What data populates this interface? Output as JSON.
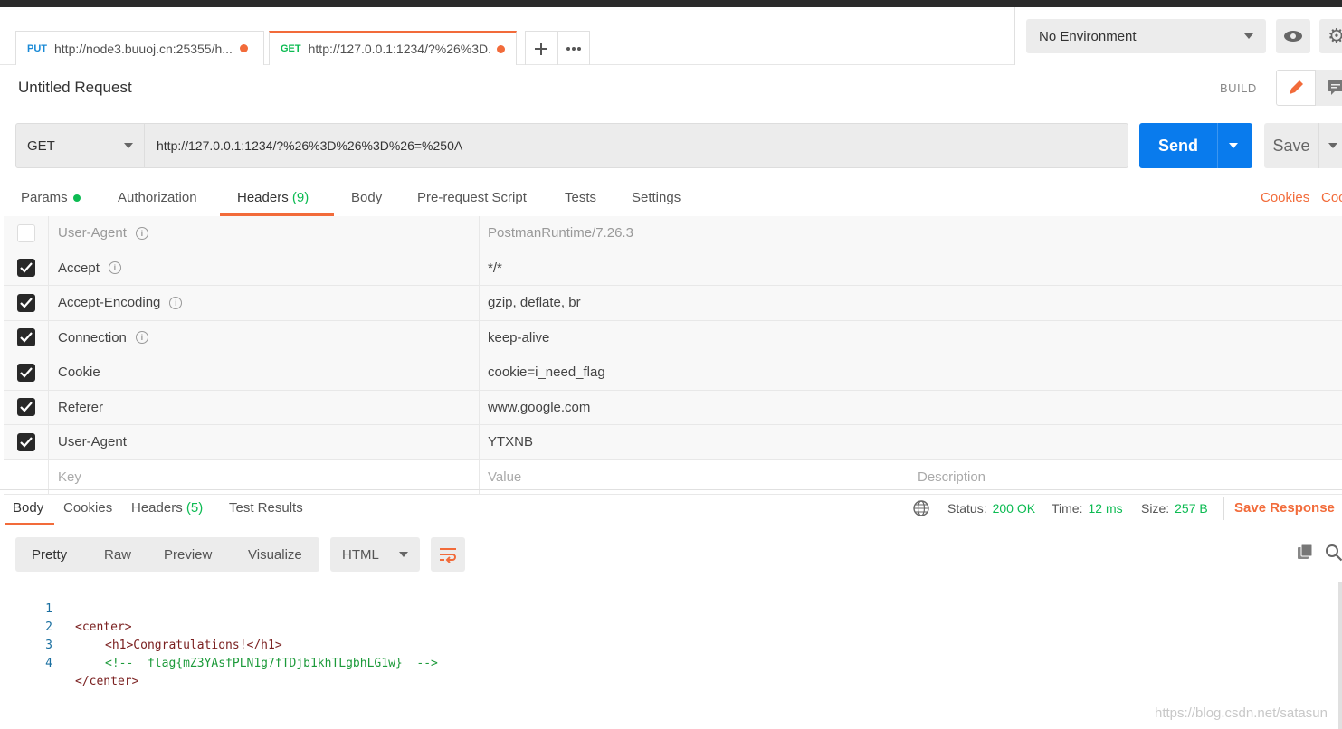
{
  "tabs": [
    {
      "method": "PUT",
      "method_color": "#1a8ad6",
      "url": "http://node3.buuoj.cn:25355/h..."
    },
    {
      "method": "GET",
      "method_color": "#0cbb52",
      "url": "http://127.0.0.1:1234/?%26%3D..."
    }
  ],
  "environment": {
    "selected": "No Environment"
  },
  "request": {
    "title": "Untitled Request",
    "build_label": "BUILD",
    "method": "GET",
    "url": "http://127.0.0.1:1234/?%26%3D%26%3D%26=%250A",
    "send_label": "Send",
    "save_label": "Save"
  },
  "request_tabs": {
    "params": "Params",
    "authorization": "Authorization",
    "headers": "Headers",
    "headers_count": "(9)",
    "body": "Body",
    "prerequest": "Pre-request Script",
    "tests": "Tests",
    "settings": "Settings",
    "cookies_link": "Cookies",
    "code_link": "Coc"
  },
  "headers": [
    {
      "key": "User-Agent",
      "value": "PostmanRuntime/7.26.3",
      "checked": false,
      "info": true
    },
    {
      "key": "Accept",
      "value": "*/*",
      "checked": true,
      "info": true
    },
    {
      "key": "Accept-Encoding",
      "value": "gzip, deflate, br",
      "checked": true,
      "info": true
    },
    {
      "key": "Connection",
      "value": "keep-alive",
      "checked": true,
      "info": true
    },
    {
      "key": "Cookie",
      "value": "cookie=i_need_flag",
      "checked": true,
      "info": false
    },
    {
      "key": "Referer",
      "value": "www.google.com",
      "checked": true,
      "info": false
    },
    {
      "key": "User-Agent",
      "value": "YTXNB",
      "checked": true,
      "info": false
    }
  ],
  "header_placeholders": {
    "key": "Key",
    "value": "Value",
    "description": "Description"
  },
  "response": {
    "tabs": {
      "body": "Body",
      "cookies": "Cookies",
      "headers": "Headers",
      "headers_count": "(5)",
      "tests": "Test Results"
    },
    "status_label": "Status:",
    "status": "200 OK",
    "time_label": "Time:",
    "time": "12 ms",
    "size_label": "Size:",
    "size": "257 B",
    "save_response": "Save Response",
    "views": {
      "pretty": "Pretty",
      "raw": "Raw",
      "preview": "Preview",
      "visualize": "Visualize"
    },
    "language": "HTML",
    "code_lines": [
      {
        "n": "1",
        "text": "<center>"
      },
      {
        "n": "2",
        "text": "<h1>Congratulations!</h1>"
      },
      {
        "n": "3",
        "text": "<!--  flag{mZ3YAsfPLN1g7fTDjb1khTLgbhLG1w}  -->"
      },
      {
        "n": "4",
        "text": "</center>"
      }
    ]
  },
  "watermark": "https://blog.csdn.net/satasun"
}
